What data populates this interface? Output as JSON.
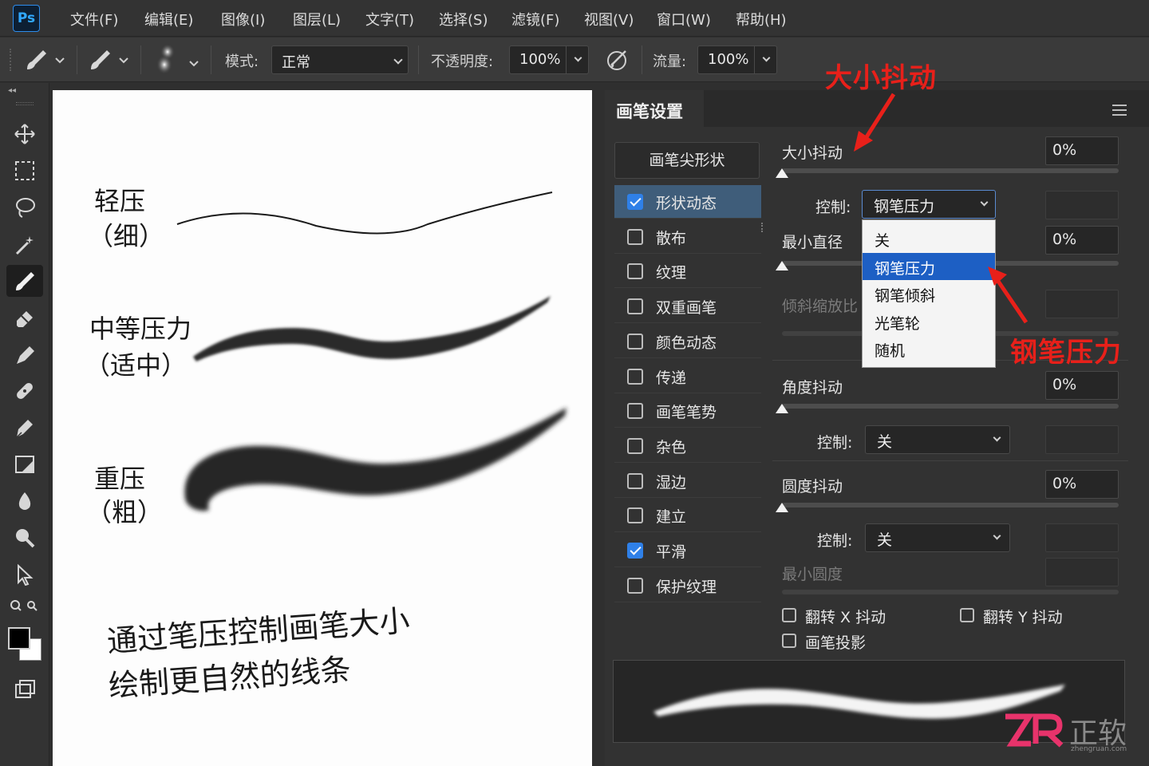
{
  "app": {
    "logo": "Ps"
  },
  "menu": [
    "文件(F)",
    "编辑(E)",
    "图像(I)",
    "图层(L)",
    "文字(T)",
    "选择(S)",
    "滤镜(F)",
    "视图(V)",
    "窗口(W)",
    "帮助(H)"
  ],
  "options": {
    "mode_label": "模式:",
    "mode_value": "正常",
    "opacity_label": "不透明度:",
    "opacity_value": "100%",
    "flow_label": "流量:",
    "flow_value": "100%"
  },
  "tools": [
    "move-icon",
    "marquee-icon",
    "lasso-icon",
    "magic-wand-icon",
    "brush-icon",
    "eraser-icon",
    "pen-icon",
    "healing-icon",
    "pen-tool-icon",
    "crop-icon",
    "blur-drop-icon",
    "dodge-icon",
    "select-arrow-icon",
    "zoom-icon"
  ],
  "canvas": {
    "light_label": "轻压",
    "light_sub": "（细）",
    "medium_label": "中等压力",
    "medium_sub": "（适中）",
    "heavy_label": "重压",
    "heavy_sub": "（粗）",
    "caption_line1": "通过笔压控制画笔大小",
    "caption_line2": "绘制更自然的线条"
  },
  "panel": {
    "title": "画笔设置",
    "tip_shape": "画笔尖形状",
    "options": [
      {
        "label": "形状动态",
        "checked": true,
        "selected": true
      },
      {
        "label": "散布",
        "checked": false
      },
      {
        "label": "纹理",
        "checked": false
      },
      {
        "label": "双重画笔",
        "checked": false
      },
      {
        "label": "颜色动态",
        "checked": false
      },
      {
        "label": "传递",
        "checked": false
      },
      {
        "label": "画笔笔势",
        "checked": false
      },
      {
        "label": "杂色",
        "checked": false
      },
      {
        "label": "湿边",
        "checked": false
      },
      {
        "label": "建立",
        "checked": false
      },
      {
        "label": "平滑",
        "checked": true
      },
      {
        "label": "保护纹理",
        "checked": false
      }
    ],
    "size_jitter_label": "大小抖动",
    "size_jitter_value": "0%",
    "control_label": "控制:",
    "control_value": "钢笔压力",
    "min_diameter_label": "最小直径",
    "min_diameter_value": "0%",
    "tilt_scale_label": "倾斜缩放比",
    "angle_jitter_label": "角度抖动",
    "angle_jitter_value": "0%",
    "angle_control_value": "关",
    "roundness_jitter_label": "圆度抖动",
    "roundness_jitter_value": "0%",
    "roundness_control_value": "关",
    "min_roundness_label": "最小圆度",
    "flip_x_label": "翻转 X 抖动",
    "flip_y_label": "翻转 Y 抖动",
    "brush_projection_label": "画笔投影",
    "dropdown": [
      "关",
      "钢笔压力",
      "钢笔倾斜",
      "光笔轮",
      "随机"
    ],
    "dropdown_selected_index": 1
  },
  "callouts": {
    "size_jitter": "大小抖动",
    "pen_pressure": "钢笔压力",
    "color": "#e8201a"
  },
  "watermark": {
    "text": "正软",
    "url": "zhengruan.com"
  }
}
